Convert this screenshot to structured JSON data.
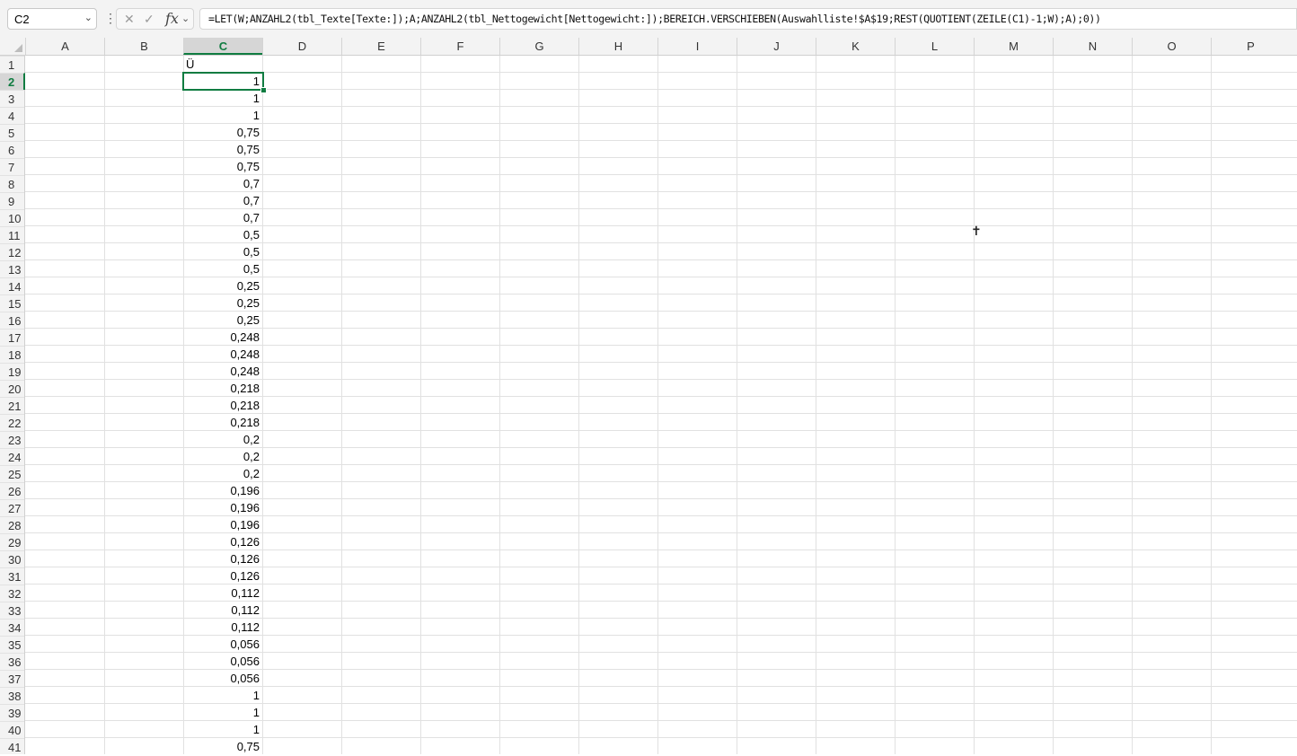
{
  "formula_bar": {
    "name_box": "C2",
    "formula": "=LET(W;ANZAHL2(tbl_Texte[Texte:]);A;ANZAHL2(tbl_Nettogewicht[Nettogewicht:]);BEREICH.VERSCHIEBEN(Auswahlliste!$A$19;REST(QUOTIENT(ZEILE(C1)-1;W);A);0))",
    "icons": [
      "chevron-down-icon",
      "more-icon",
      "cancel-icon",
      "enter-icon",
      "function-icon"
    ]
  },
  "columns": [
    "A",
    "B",
    "C",
    "D",
    "E",
    "F",
    "G",
    "H",
    "I",
    "J",
    "K",
    "L",
    "M",
    "N",
    "O",
    "P"
  ],
  "selected_column": "C",
  "selected_row": 2,
  "rows": [
    "1",
    "2",
    "3",
    "4",
    "5",
    "6",
    "7",
    "8",
    "9",
    "10",
    "11",
    "12",
    "13",
    "14",
    "15",
    "16",
    "17",
    "18",
    "19",
    "20",
    "21",
    "22",
    "23",
    "24",
    "25",
    "26",
    "27",
    "28",
    "29",
    "30",
    "31",
    "32",
    "33",
    "34",
    "35",
    "36",
    "37",
    "38",
    "39",
    "40",
    "41"
  ],
  "column_c_values": [
    "Ü",
    "1",
    "1",
    "1",
    "0,75",
    "0,75",
    "0,75",
    "0,7",
    "0,7",
    "0,7",
    "0,5",
    "0,5",
    "0,5",
    "0,25",
    "0,25",
    "0,25",
    "0,248",
    "0,248",
    "0,248",
    "0,218",
    "0,218",
    "0,218",
    "0,2",
    "0,2",
    "0,2",
    "0,196",
    "0,196",
    "0,196",
    "0,126",
    "0,126",
    "0,126",
    "0,112",
    "0,112",
    "0,112",
    "0,056",
    "0,056",
    "0,056",
    "1",
    "1",
    "1",
    "0,75"
  ],
  "accent_color": "#107c41"
}
